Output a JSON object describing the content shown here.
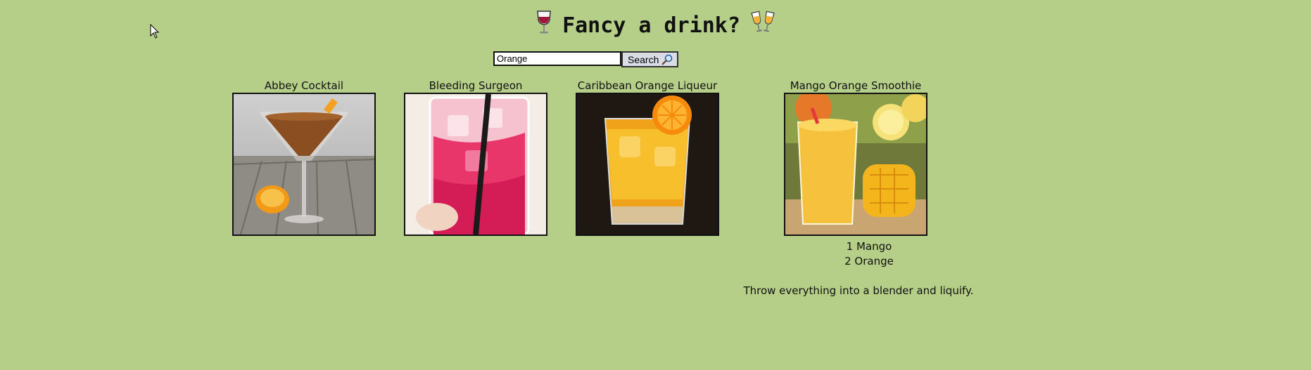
{
  "header": {
    "title": "Fancy a drink?",
    "left_icon": "wine-glass-icon",
    "right_icon": "clinking-glasses-icon"
  },
  "search": {
    "value": "Orange",
    "button_label": "Search",
    "button_icon": "magnifier-icon"
  },
  "results": [
    {
      "name": "Abbey Cocktail",
      "image": "martini-glass-orange-photo"
    },
    {
      "name": "Bleeding Surgeon",
      "image": "pink-drink-with-straw-photo"
    },
    {
      "name": "Caribbean Orange Liqueur",
      "image": "orange-drink-glass-photo"
    },
    {
      "name": "Mango Orange Smoothie",
      "image": "mango-smoothie-photo"
    }
  ],
  "selected_recipe": {
    "ingredients": [
      "1 Mango",
      "2 Orange"
    ],
    "instructions": "Throw everything into a blender and liquify."
  },
  "colors": {
    "background": "#b5cf88",
    "button_background": "#dadde6"
  }
}
